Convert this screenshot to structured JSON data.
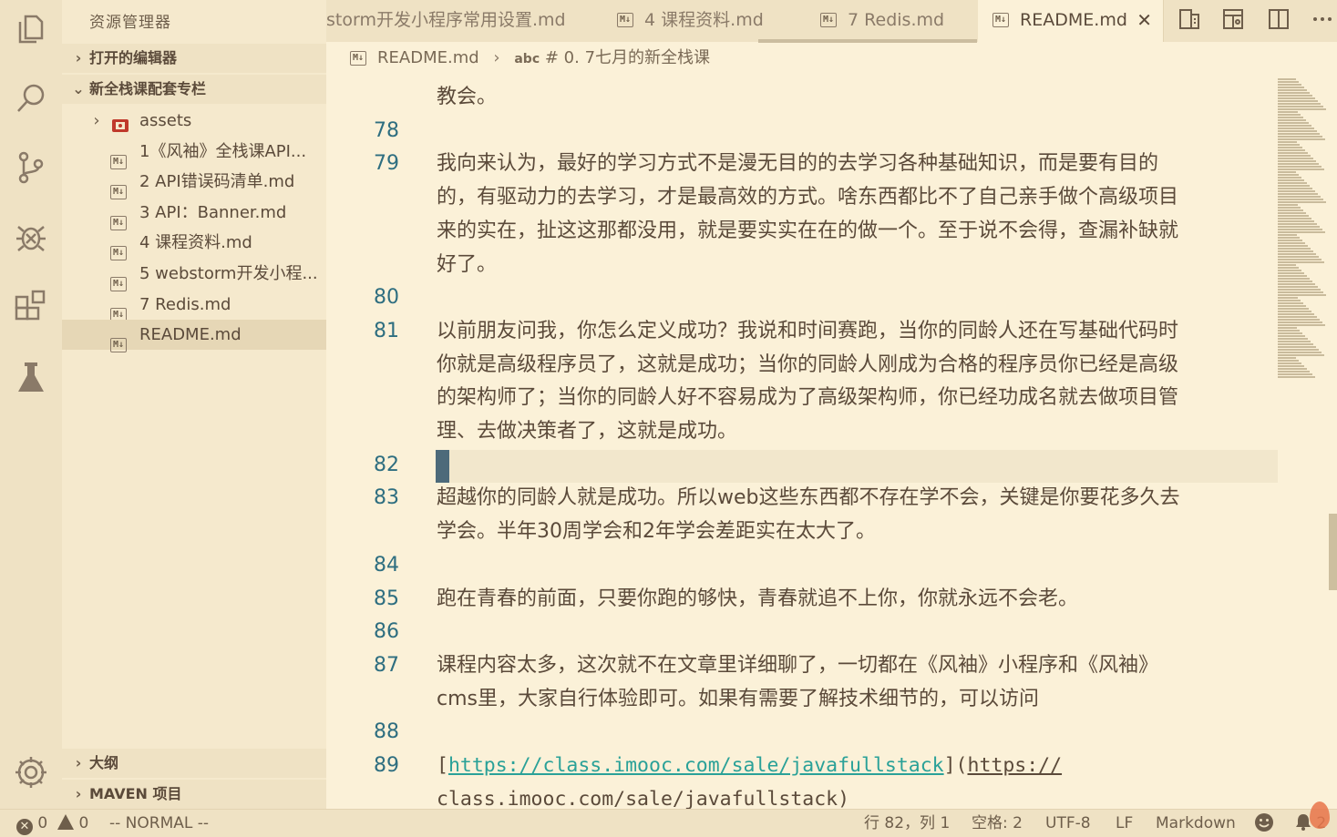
{
  "sidebar": {
    "title": "资源管理器",
    "open_editors_label": "打开的编辑器",
    "folder_label": "新全栈课配套专栏",
    "items": [
      {
        "label": "assets",
        "type": "folder"
      },
      {
        "label": "1《风袖》全栈课API...",
        "type": "md"
      },
      {
        "label": "2 API错误码清单.md",
        "type": "md"
      },
      {
        "label": "3 API：Banner.md",
        "type": "md"
      },
      {
        "label": "4 课程资料.md",
        "type": "md"
      },
      {
        "label": "5 webstorm开发小程...",
        "type": "md"
      },
      {
        "label": "7 Redis.md",
        "type": "md"
      },
      {
        "label": "README.md",
        "type": "md",
        "selected": true
      }
    ],
    "outline_label": "大纲",
    "maven_label": "MAVEN 项目"
  },
  "tabs": [
    {
      "label": "storm开发小程序常用设置.md",
      "active": false
    },
    {
      "label": "4 课程资料.md",
      "active": false
    },
    {
      "label": "7 Redis.md",
      "active": false
    },
    {
      "label": "README.md",
      "active": true
    }
  ],
  "md_badge": "M↓",
  "breadcrumb": {
    "file": "README.md",
    "separator": "›",
    "symbol_prefix": "abc",
    "symbol": "# 0. 7七月的新全栈课"
  },
  "editor": {
    "lines": [
      {
        "num": "",
        "text": "教会。"
      },
      {
        "num": "78",
        "text": ""
      },
      {
        "num": "79",
        "text": "我向来认为，最好的学习方式不是漫无目的的去学习各种基础知识，而是要有目的"
      },
      {
        "num": "",
        "text": "的，有驱动力的去学习，才是最高效的方式。啥东西都比不了自己亲手做个高级项目"
      },
      {
        "num": "",
        "text": "来的实在，扯这这那都没用，就是要实实在在的做一个。至于说不会得，查漏补缺就"
      },
      {
        "num": "",
        "text": "好了。"
      },
      {
        "num": "80",
        "text": ""
      },
      {
        "num": "81",
        "text": "以前朋友问我，你怎么定义成功？我说和时间赛跑，当你的同龄人还在写基础代码时"
      },
      {
        "num": "",
        "text": "你就是高级程序员了，这就是成功；当你的同龄人刚成为合格的程序员你已经是高级"
      },
      {
        "num": "",
        "text": "的架构师了；当你的同龄人好不容易成为了高级架构师，你已经功成名就去做项目管"
      },
      {
        "num": "",
        "text": "理、去做决策者了，这就是成功。"
      },
      {
        "num": "82",
        "text": ""
      },
      {
        "num": "83",
        "text": "超越你的同龄人就是成功。所以web这些东西都不存在学不会，关键是你要花多久去"
      },
      {
        "num": "",
        "text": "学会。半年30周学会和2年学会差距实在太大了。"
      },
      {
        "num": "84",
        "text": ""
      },
      {
        "num": "85",
        "text": "跑在青春的前面，只要你跑的够快，青春就追不上你，你就永远不会老。"
      },
      {
        "num": "86",
        "text": ""
      },
      {
        "num": "87",
        "text": "课程内容太多，这次就不在文章里详细聊了，一切都在《风袖》小程序和《风袖》"
      },
      {
        "num": "",
        "text": "cms里，大家自行体验即可。如果有需要了解技术细节的，可以访问"
      },
      {
        "num": "88",
        "text": ""
      }
    ],
    "link_line": {
      "num": "89",
      "open": "[",
      "link_text": "https://class.imooc.com/sale/javafullstack",
      "mid": "](",
      "url_part1": "https://",
      "url_part2": "class.imooc.com/sale/javafullstack)"
    }
  },
  "statusbar": {
    "errors": "0",
    "warnings": "0",
    "vim_mode": "-- NORMAL --",
    "position": "行 82，列 1",
    "indent": "空格: 2",
    "encoding": "UTF-8",
    "eol": "LF",
    "language": "Markdown",
    "notifications": "2"
  },
  "icons": {
    "activity": [
      "explorer-icon",
      "search-icon",
      "source-control-icon",
      "debug-icon",
      "extensions-icon",
      "test-flask-icon",
      "settings-gear-icon"
    ]
  },
  "colors": {
    "background": "#fbf1d8",
    "sidebar": "#f5e9cd",
    "line_number": "#2e6e80",
    "link": "#2aa198",
    "cursor": "#4d6a7a"
  }
}
